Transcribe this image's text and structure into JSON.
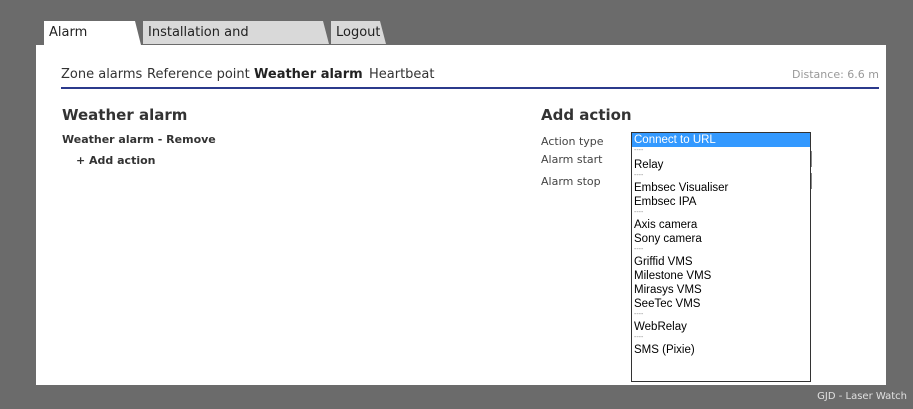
{
  "tabs": [
    {
      "label": "Alarm settings",
      "active": true
    },
    {
      "label": "Installation and configuration",
      "active": false
    },
    {
      "label": "Logout",
      "active": false
    }
  ],
  "subnav": {
    "items": [
      "Zone alarms",
      "Reference point",
      "Weather alarm",
      "Heartbeat"
    ],
    "active": "Weather alarm",
    "distance": "Distance: 6.6 m"
  },
  "weather": {
    "heading": "Weather alarm",
    "row_name": "Weather alarm",
    "separator": " - ",
    "remove": "Remove",
    "add_action": "+ Add action"
  },
  "add_action": {
    "heading": "Add action",
    "labels": {
      "action_type": "Action type",
      "alarm_start": "Alarm start",
      "alarm_stop": "Alarm stop"
    }
  },
  "dropdown": {
    "selected": "Connect to URL",
    "options": [
      "Connect to URL",
      "Relay",
      "Embsec Visualiser",
      "Embsec IPA",
      "Axis camera",
      "Sony camera",
      "Griffid VMS",
      "Milestone VMS",
      "Mirasys VMS",
      "SeeTec VMS",
      "WebRelay",
      "SMS (Pixie)"
    ],
    "separator": "----"
  },
  "footer": "GJD - Laser Watch",
  "colors": {
    "accent_line": "#2b3a8c",
    "selection": "#3399ff",
    "background": "#6b6b6b"
  }
}
